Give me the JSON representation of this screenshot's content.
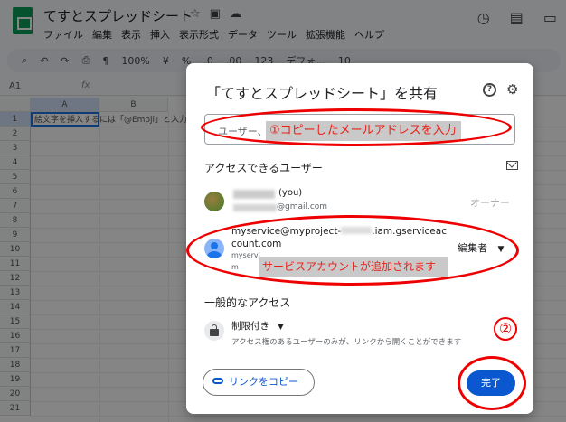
{
  "sheet": {
    "doc_title": "てすとスプレッドシート",
    "menu": [
      "ファイル",
      "編集",
      "表示",
      "挿入",
      "表示形式",
      "データ",
      "ツール",
      "拡張機能",
      "ヘルプ"
    ],
    "toolbar": {
      "zoom": "100%",
      "currency": "¥",
      "percent": "%",
      "decimals": ".0",
      "decimals2": ".00",
      "format123": "123",
      "font": "デフォ...",
      "font_size": "10"
    },
    "cell_ref": "A1",
    "fx": "fx",
    "columns": [
      "A",
      "B"
    ],
    "rows": [
      "1",
      "2",
      "3",
      "4",
      "5",
      "6",
      "7",
      "8",
      "9",
      "10",
      "11",
      "12",
      "13",
      "14",
      "15",
      "16",
      "17",
      "18",
      "19",
      "20",
      "21"
    ],
    "a1_text": "絵文字を挿入するには「@Emoji」と入力し"
  },
  "dialog": {
    "title": "「てすとスプレッドシート」を共有",
    "add_placeholder": "ユーザー、",
    "annotation_1": "①コピーしたメールアドレスを入力",
    "access_label": "アクセスできるユーザー",
    "owner": {
      "you": "(you)",
      "email_suffix": "@gmail.com",
      "role": "オーナー"
    },
    "service_account": {
      "line1": "myservice@myproject-",
      "line1_end": ".iam.gserviceac",
      "line2": "count.com",
      "small1": "myservi",
      "small2": "m",
      "role": "編集者"
    },
    "annotation_2": "サービスアカウントが追加されます",
    "general_access_label": "一般的なアクセス",
    "restriction": "制限付き",
    "restriction_desc": "アクセス権のあるユーザーのみが、リンクから開くことができます",
    "copy_link": "リンクをコピー",
    "done": "完了",
    "annotation_3": "②"
  },
  "colors": {
    "primary": "#0b57d0",
    "annotation_red": "#e00000",
    "sheets_green": "#0f9d58"
  }
}
